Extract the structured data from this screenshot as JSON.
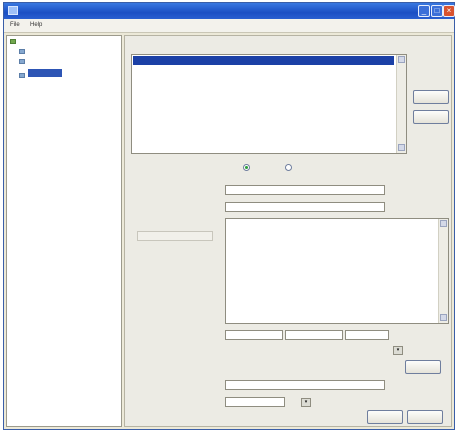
{
  "window": {
    "title": ""
  },
  "menu": [
    "File",
    "Help"
  ],
  "tree": {
    "root": "",
    "items": [
      {
        "label": "",
        "selected": false
      },
      {
        "label": "",
        "selected": false
      },
      {
        "label": "",
        "selected": true
      }
    ]
  },
  "content": {
    "section_title": "",
    "list": {
      "rows": [
        {
          "label": "",
          "selected": true
        }
      ]
    },
    "side_buttons": [
      "",
      ""
    ],
    "description_label": "",
    "options": [
      "",
      ""
    ],
    "fields": {
      "name": {
        "label": "",
        "value": ""
      },
      "display_name": {
        "label": "",
        "value": ""
      },
      "body": {
        "label": "",
        "hint": ""
      },
      "param_label": "",
      "params": [
        "",
        "",
        ""
      ],
      "output_label": "",
      "output_value": "",
      "type_label": "",
      "type_value": ""
    },
    "buttons": {
      "side_small": "",
      "confirm": "",
      "cancel": ""
    }
  }
}
